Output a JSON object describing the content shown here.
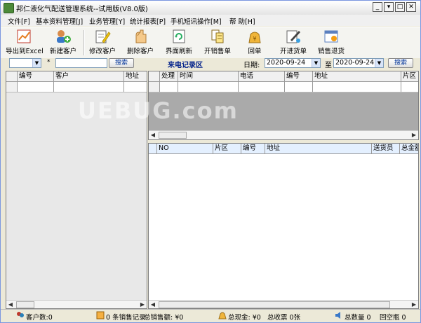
{
  "window": {
    "title": "邦仁液化气配送管理系统--试用版(V8.0版)",
    "controls": [
      "_",
      "▾",
      "□",
      "✕"
    ]
  },
  "menu": [
    "文件[F]",
    "基本资料管理[J]",
    "业务管理[Y]",
    "统计报表[P]",
    "手机短讯操作[M]",
    "帮 助[H]"
  ],
  "toolbar": [
    {
      "label": "导出到Excel",
      "icon": "excel-export-icon"
    },
    {
      "label": "新建客户",
      "icon": "add-customer-icon"
    },
    {
      "label": "修改客户",
      "icon": "edit-customer-icon"
    },
    {
      "label": "删除客户",
      "icon": "delete-customer-icon"
    },
    {
      "label": "界面刷新",
      "icon": "refresh-icon"
    },
    {
      "label": "开销售单",
      "icon": "sales-order-icon"
    },
    {
      "label": "回单",
      "icon": "return-order-icon"
    },
    {
      "label": "开进货单",
      "icon": "purchase-order-icon"
    },
    {
      "label": "销售退货",
      "icon": "sales-return-icon"
    }
  ],
  "filter": {
    "field_value": "",
    "asterisk": "*",
    "search_label": "搜索",
    "area_title": "来电记录区",
    "date_label": "日期:",
    "date_from": "2020-09-24",
    "to_label": "至",
    "date_to": "2020-09-24",
    "search2_label": "搜索"
  },
  "customer_table": {
    "columns": [
      "编号",
      "客户",
      "地址"
    ]
  },
  "call_table": {
    "columns": [
      "处理",
      "时间",
      "电话",
      "编号",
      "地址",
      "片区"
    ]
  },
  "order_table": {
    "columns": [
      "NO",
      "片区",
      "编号",
      "地址",
      "送货员",
      "总金额"
    ]
  },
  "watermark": "UEBUG.com",
  "status": {
    "customer_count": "客户数:0",
    "sales_records": "0 条销售记录",
    "sales_total": "总销售额: ¥0",
    "cash_total": "总现金: ¥0",
    "receipt_total": "总收票 0张",
    "quantity_total": "总数量 0",
    "empty_return": "回空瓶 0"
  },
  "colors": {
    "titlebar": "#e4e4e4",
    "panel_gray": "#aaaaaa",
    "header_blue": "#e4f0ff",
    "accent_link": "#003399"
  }
}
